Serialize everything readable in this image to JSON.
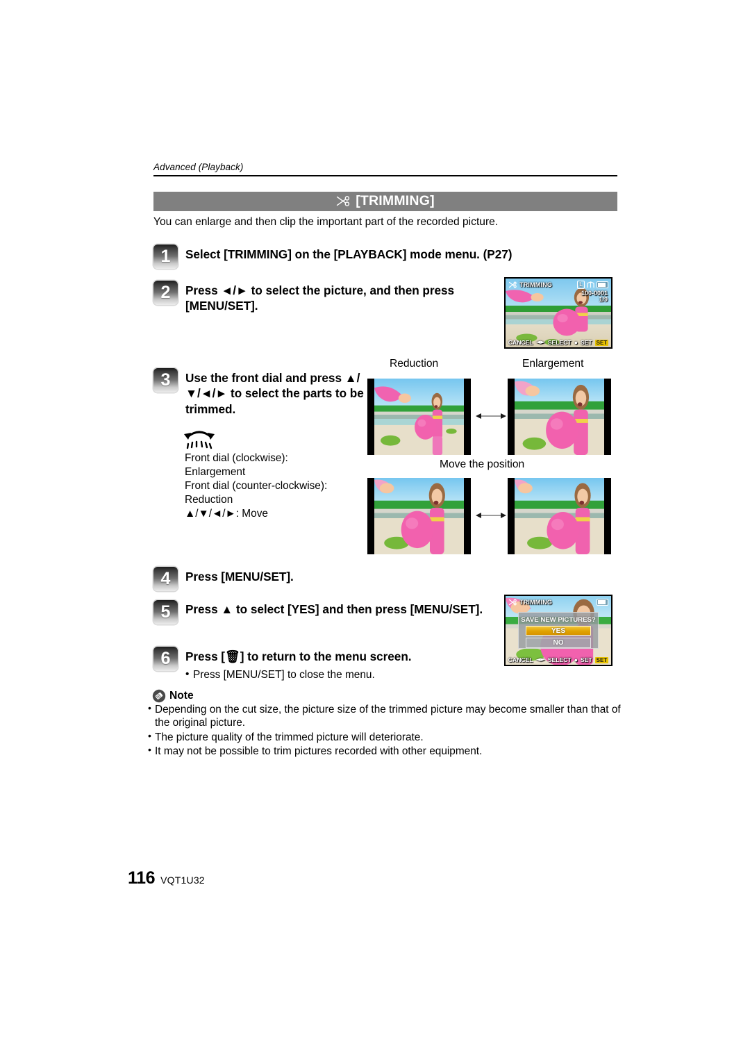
{
  "running_head": "Advanced (Playback)",
  "section": {
    "icon": "scissors-icon",
    "title": "[TRIMMING]"
  },
  "intro": "You can enlarge and then clip the important part of the recorded picture.",
  "steps": [
    {
      "number": "1",
      "text": "Select [TRIMMING] on the [PLAYBACK] mode menu. (P27)"
    },
    {
      "number": "2",
      "text": "Press ◄/► to select the picture, and then press [MENU/SET]."
    },
    {
      "number": "3",
      "text": "Use the front dial and press ▲/▼/◄/► to select the parts to be trimmed."
    },
    {
      "number": "4",
      "text": "Press [MENU/SET]."
    },
    {
      "number": "5",
      "text": "Press ▲ to select [YES] and then press [MENU/SET]."
    },
    {
      "number": "6",
      "text": "Press [🗑] to return to the menu screen."
    }
  ],
  "dial": {
    "icon": "dial-rotation-icon",
    "lines": "Front dial (clockwise):\nEnlargement\nFront dial (counter-clockwise):\nReduction\n▲/▼/◄/►: Move"
  },
  "figure_labels": {
    "reduction": "Reduction",
    "enlargement": "Enlargement",
    "move_position": "Move the position"
  },
  "lcd_select": {
    "osd_title": "TRIMMING",
    "quality_chip": "L",
    "fine_icon": "fine-quality-icon",
    "battery_icon": "battery-full-icon",
    "file_number": "100-0001",
    "file_number_2": "1/9",
    "bottom_cancel": "CANCEL",
    "bottom_arrows": "◄►",
    "bottom_select": "SELECT",
    "bottom_dial": "●",
    "bottom_set_label": "SET",
    "bottom_set_chip": "SET"
  },
  "lcd_save": {
    "osd_title": "TRIMMING",
    "battery_icon": "battery-full-icon",
    "dialog_title": "SAVE NEW PICTURES?",
    "option_yes": "YES",
    "option_no": "NO",
    "bottom_cancel": "CANCEL",
    "bottom_arrows": "◄►",
    "bottom_select": "SELECT",
    "bottom_dial": "●",
    "bottom_set_label": "SET",
    "bottom_set_chip": "SET"
  },
  "step6_sub_bullet": "Press [MENU/SET] to close the menu.",
  "note": {
    "icon": "note-pencil-icon",
    "label": "Note",
    "items": [
      "Depending on the cut size, the picture size of the trimmed picture may become smaller than that of the original picture.",
      "The picture quality of the trimmed picture will deteriorate.",
      "It may not be possible to trim pictures recorded with other equipment."
    ]
  },
  "footer": {
    "page_number": "116",
    "document_number": "VQT1U32"
  },
  "colors": {
    "title_bar": "#808080",
    "badge_light": "#ededed",
    "badge_dark": "#1c1c1c",
    "set_chip": "#e8c200",
    "yes_highlight": "#e0a200"
  }
}
